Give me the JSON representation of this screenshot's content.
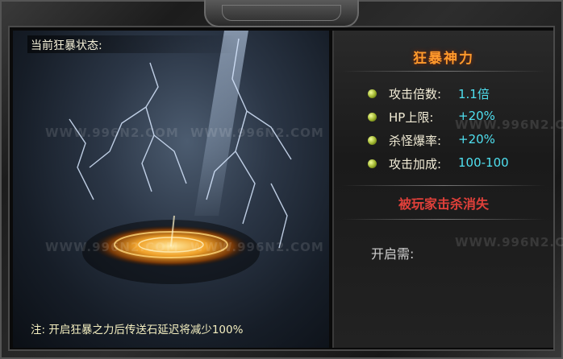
{
  "left": {
    "status_title": "当前狂暴状态:",
    "note": "注: 开启狂暴之力后传送石延迟将减少100%"
  },
  "right": {
    "title": "狂暴神力",
    "stats": [
      {
        "label": "攻击倍数:",
        "value": "1.1倍"
      },
      {
        "label": "HP上限:",
        "value": "+20%"
      },
      {
        "label": "杀怪爆率:",
        "value": "+20%"
      },
      {
        "label": "攻击加成:",
        "value": "100-100"
      }
    ],
    "warning": "被玩家击杀消失",
    "open_requirement": "开启需:"
  },
  "watermark": "WWW.996N2.COM",
  "colors": {
    "title": "#ff9a2c",
    "value": "#4fe0f0",
    "warning": "#e0403a",
    "note": "#f4efc0"
  }
}
